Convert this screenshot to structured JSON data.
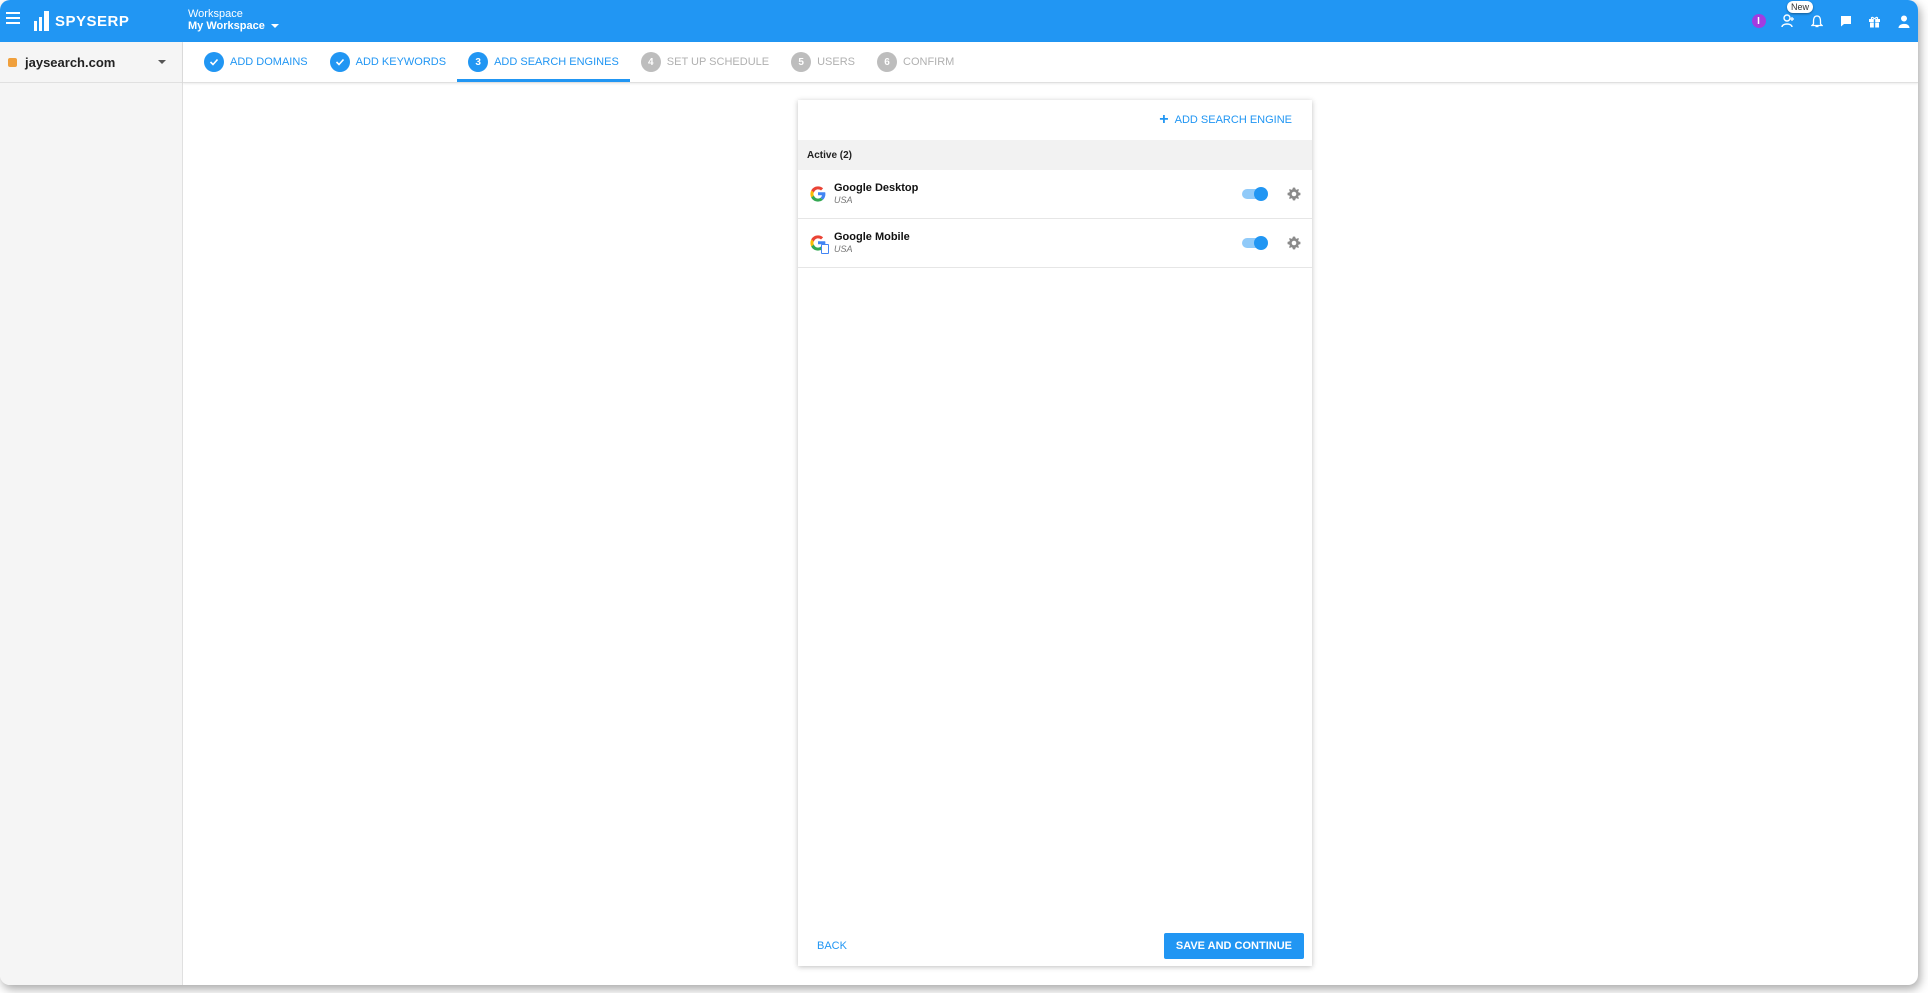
{
  "app": {
    "brand": "SPYSERP",
    "accent": "#2196f3"
  },
  "workspace": {
    "label": "Workspace",
    "name": "My Workspace"
  },
  "header_icons": {
    "notification_badge_text": "I",
    "new_badge": "New",
    "icons": [
      "add-user-icon",
      "bell-icon",
      "chat-icon",
      "gift-icon",
      "user-icon"
    ]
  },
  "sidebar": {
    "domain": "jaysearch.com"
  },
  "steps": [
    {
      "label": "ADD DOMAINS",
      "num": "1",
      "state": "done"
    },
    {
      "label": "ADD KEYWORDS",
      "num": "2",
      "state": "done"
    },
    {
      "label": "ADD SEARCH ENGINES",
      "num": "3",
      "state": "active"
    },
    {
      "label": "SET UP SCHEDULE",
      "num": "4",
      "state": "todo"
    },
    {
      "label": "USERS",
      "num": "5",
      "state": "todo"
    },
    {
      "label": "CONFIRM",
      "num": "6",
      "state": "todo"
    }
  ],
  "card": {
    "add_engine_label": "ADD SEARCH ENGINE",
    "section_title": "Active (2)",
    "engines": [
      {
        "name": "Google Desktop",
        "country": "USA",
        "enabled": true
      },
      {
        "name": "Google Mobile",
        "country": "USA",
        "enabled": true
      }
    ],
    "back_label": "BACK",
    "save_label": "SAVE AND CONTINUE"
  }
}
